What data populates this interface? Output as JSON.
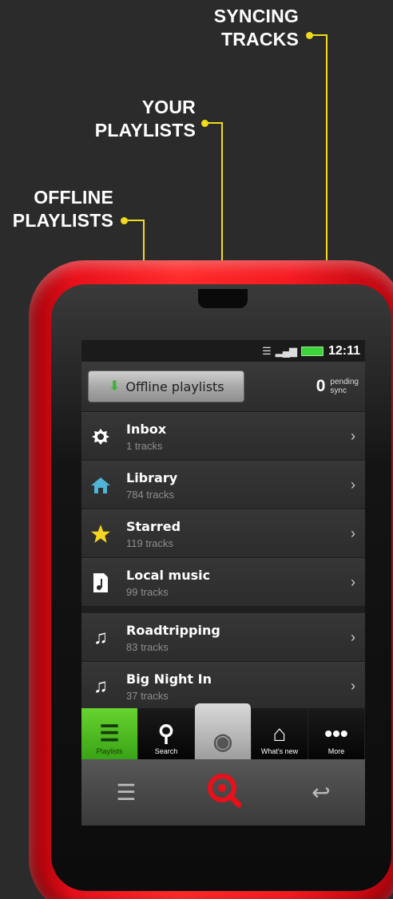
{
  "callouts": {
    "syncing": [
      "SYNCING",
      "TRACKS"
    ],
    "your": [
      "YOUR",
      "PLAYLISTS"
    ],
    "offline": [
      "OFFLINE",
      "PLAYLISTS"
    ]
  },
  "status": {
    "time": "12:11",
    "signal_icon": "signal-icon",
    "wifi_icon": "wifi-icon"
  },
  "top": {
    "offline_label": "Offline playlists",
    "pending_count": "0",
    "pending_line1": "pending",
    "pending_line2": "sync"
  },
  "rows": [
    {
      "title": "Inbox",
      "sub": "1 tracks",
      "icon": "inbox-icon"
    },
    {
      "title": "Library",
      "sub": "784 tracks",
      "icon": "library-icon"
    },
    {
      "title": "Starred",
      "sub": "119 tracks",
      "icon": "star-icon"
    },
    {
      "title": "Local music",
      "sub": "99 tracks",
      "icon": "local-music-icon"
    }
  ],
  "playlists": [
    {
      "title": "Roadtripping",
      "sub": "83 tracks",
      "icon": "music-note-icon"
    },
    {
      "title": "Big Night In",
      "sub": "37 tracks",
      "icon": "music-note-icon"
    }
  ],
  "tabs": [
    {
      "label": "Playlists",
      "icon": "playlists-icon",
      "active": true
    },
    {
      "label": "Search",
      "icon": "search-icon"
    },
    {
      "label": "",
      "icon": "now-playing-icon"
    },
    {
      "label": "What's new",
      "icon": "home-icon"
    },
    {
      "label": "More",
      "icon": "more-icon"
    }
  ],
  "accent": "#f2dc1b",
  "brand": "#e8101a"
}
